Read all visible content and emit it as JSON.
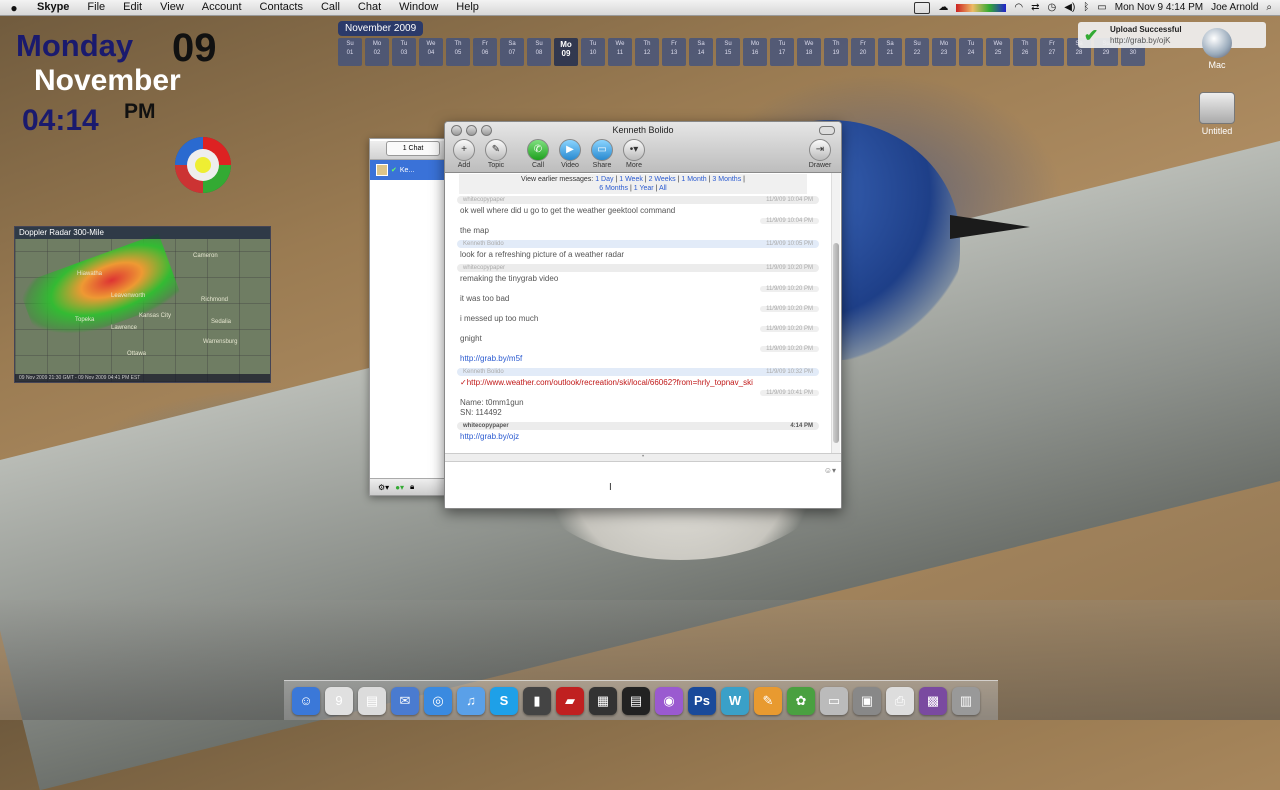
{
  "menubar": {
    "app": "Skype",
    "items": [
      "File",
      "Edit",
      "View",
      "Account",
      "Contacts",
      "Call",
      "Chat",
      "Window",
      "Help"
    ],
    "clock": "Mon Nov 9  4:14 PM",
    "user": "Joe Arnold"
  },
  "calendar": {
    "month": "November 2009",
    "days": [
      {
        "d": "Su",
        "n": "01"
      },
      {
        "d": "Mo",
        "n": "02"
      },
      {
        "d": "Tu",
        "n": "03"
      },
      {
        "d": "We",
        "n": "04"
      },
      {
        "d": "Th",
        "n": "05"
      },
      {
        "d": "Fr",
        "n": "06"
      },
      {
        "d": "Sa",
        "n": "07"
      },
      {
        "d": "Su",
        "n": "08"
      },
      {
        "d": "Mo",
        "n": "09"
      },
      {
        "d": "Tu",
        "n": "10"
      },
      {
        "d": "We",
        "n": "11"
      },
      {
        "d": "Th",
        "n": "12"
      },
      {
        "d": "Fr",
        "n": "13"
      },
      {
        "d": "Sa",
        "n": "14"
      },
      {
        "d": "Su",
        "n": "15"
      },
      {
        "d": "Mo",
        "n": "16"
      },
      {
        "d": "Tu",
        "n": "17"
      },
      {
        "d": "We",
        "n": "18"
      },
      {
        "d": "Th",
        "n": "19"
      },
      {
        "d": "Fr",
        "n": "20"
      },
      {
        "d": "Sa",
        "n": "21"
      },
      {
        "d": "Su",
        "n": "22"
      },
      {
        "d": "Mo",
        "n": "23"
      },
      {
        "d": "Tu",
        "n": "24"
      },
      {
        "d": "We",
        "n": "25"
      },
      {
        "d": "Th",
        "n": "26"
      },
      {
        "d": "Fr",
        "n": "27"
      },
      {
        "d": "Sa",
        "n": "28"
      },
      {
        "d": "Su",
        "n": "29"
      },
      {
        "d": "Mo",
        "n": "30"
      }
    ],
    "today_index": 8
  },
  "geektool": {
    "weekday": "Monday",
    "day": "09",
    "month": "November",
    "time": "04:14",
    "ampm": "PM"
  },
  "radar": {
    "title": "Doppler Radar 300-Mile",
    "cities": [
      "Cameron",
      "Hiawatha",
      "Leavenworth",
      "Richmond",
      "Topeka",
      "Kansas City",
      "Sedalia",
      "Lawrence",
      "Warrensburg",
      "Ottawa"
    ],
    "footer": "09 Nov 2009 21:30 GMT - 09 Nov 2009 04:41 PM EST"
  },
  "notification": {
    "title": "Upload Successful",
    "url": "http://grab.by/ojK"
  },
  "desktop": {
    "icons": [
      "Mac",
      "Untitled"
    ]
  },
  "chat_list": {
    "selector": "1 Chat",
    "item": "Ke..."
  },
  "chat": {
    "title": "Kenneth Bolido",
    "toolbar": {
      "add": "Add",
      "topic": "Topic",
      "call": "Call",
      "video": "Video",
      "share": "Share",
      "more": "More",
      "drawer": "Drawer"
    },
    "earlier": {
      "label": "View earlier messages:",
      "links": [
        "1 Day",
        "1 Week",
        "2 Weeks",
        "1 Month",
        "3 Months",
        "6 Months",
        "1 Year",
        "All"
      ]
    },
    "messages": [
      {
        "author": "whitecopypaper",
        "time": "11/9/09 10:04 PM",
        "text": "ok well where did u go to get the weather  geektool command",
        "kind": "w"
      },
      {
        "author": "",
        "time": "11/9/09 10:04 PM",
        "text": "the map",
        "kind": "cont"
      },
      {
        "author": "Kenneth Bolido",
        "time": "11/9/09 10:05 PM",
        "text": "look for a refreshing picture of a weather radar",
        "kind": "k"
      },
      {
        "author": "whitecopypaper",
        "time": "11/9/09 10:20 PM",
        "text": "remaking the tinygrab video",
        "kind": "w"
      },
      {
        "author": "",
        "time": "11/9/09 10:20 PM",
        "text": "it was too bad",
        "kind": "cont"
      },
      {
        "author": "",
        "time": "11/9/09 10:20 PM",
        "text": "i messed up too much",
        "kind": "cont"
      },
      {
        "author": "",
        "time": "11/9/09 10:20 PM",
        "text": "gnight",
        "kind": "cont"
      },
      {
        "author": "",
        "time": "11/9/09 10:20 PM",
        "text": "http://grab.by/m5f",
        "kind": "link"
      },
      {
        "author": "Kenneth Bolido",
        "time": "11/9/09 10:32 PM",
        "text": "✓http://www.weather.com/outlook/recreation/ski/local/66062?from=hrly_topnav_ski",
        "kind": "err"
      },
      {
        "author": "",
        "time": "11/9/09 10:41 PM",
        "text": "Name: t0mm1gun\nSN: 114492",
        "kind": "cont"
      },
      {
        "author": "whitecopypaper",
        "time": "4:14 PM",
        "text": "http://grab.by/ojz",
        "kind": "wlink"
      }
    ]
  },
  "dock": {
    "icons": [
      {
        "name": "finder-icon",
        "glyph": "☺",
        "color": "#3b78d8"
      },
      {
        "name": "ical-icon",
        "glyph": "9",
        "color": "#e0e0e0"
      },
      {
        "name": "preview-icon",
        "glyph": "▤",
        "color": "#dcdcdc"
      },
      {
        "name": "mail-icon",
        "glyph": "✉",
        "color": "#4a7bd0"
      },
      {
        "name": "safari-icon",
        "glyph": "◎",
        "color": "#3a8ae0"
      },
      {
        "name": "itunes-icon",
        "glyph": "♫",
        "color": "#5aa0e8"
      },
      {
        "name": "skype-icon",
        "glyph": "S",
        "color": "#1ea0e8"
      },
      {
        "name": "trash-can-icon",
        "glyph": "▮",
        "color": "#444"
      },
      {
        "name": "book-icon",
        "glyph": "▰",
        "color": "#c02020"
      },
      {
        "name": "film-icon",
        "glyph": "▦",
        "color": "#333"
      },
      {
        "name": "clapper-icon",
        "glyph": "▤",
        "color": "#222"
      },
      {
        "name": "color-wheel-icon",
        "glyph": "◉",
        "color": "#9a5ad0"
      },
      {
        "name": "photoshop-icon",
        "glyph": "Ps",
        "color": "#1a4a9a"
      },
      {
        "name": "dreamweaver-icon",
        "glyph": "W",
        "color": "#3aa0c8"
      },
      {
        "name": "brush-icon",
        "glyph": "✎",
        "color": "#e89a30"
      },
      {
        "name": "plant-icon",
        "glyph": "✿",
        "color": "#4aa040"
      },
      {
        "name": "drive-icon",
        "glyph": "▭",
        "color": "#bbb"
      },
      {
        "name": "screenshot-icon",
        "glyph": "▣",
        "color": "#888"
      },
      {
        "name": "printer-icon",
        "glyph": "⎙",
        "color": "#ddd"
      },
      {
        "name": "media-icon",
        "glyph": "▩",
        "color": "#7a4aa0"
      },
      {
        "name": "trash-icon",
        "glyph": "▥",
        "color": "#999"
      }
    ]
  }
}
